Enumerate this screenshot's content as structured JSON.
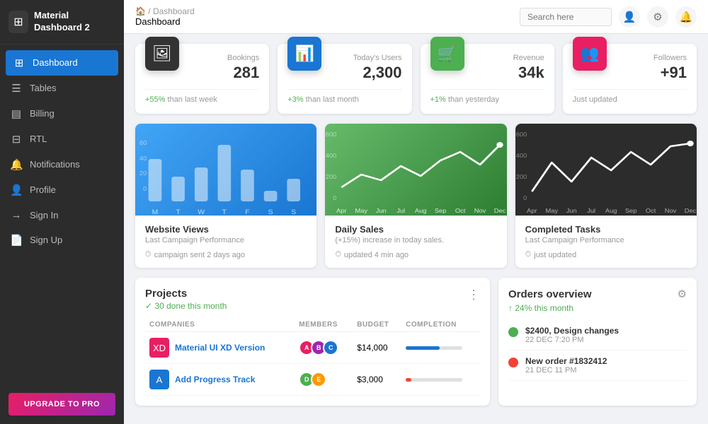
{
  "sidebar": {
    "logo": "Material Dashboard 2",
    "items": [
      {
        "label": "Dashboard",
        "icon": "⊞",
        "active": true
      },
      {
        "label": "Tables",
        "icon": "☰",
        "active": false
      },
      {
        "label": "Billing",
        "icon": "▤",
        "active": false
      },
      {
        "label": "RTL",
        "icon": "⊟",
        "active": false
      },
      {
        "label": "Notifications",
        "icon": "🔔",
        "active": false
      },
      {
        "label": "Profile",
        "icon": "👤",
        "active": false
      },
      {
        "label": "Sign In",
        "icon": "→",
        "active": false
      },
      {
        "label": "Sign Up",
        "icon": "📄",
        "active": false
      }
    ],
    "upgrade_label": "UPGRADE TO PRO"
  },
  "header": {
    "breadcrumb_home": "🏠",
    "breadcrumb_separator": "/",
    "breadcrumb_page": "Dashboard",
    "title": "Dashboard",
    "search_placeholder": "Search here",
    "icons": [
      "👤",
      "⚙",
      "🔔"
    ]
  },
  "stats": [
    {
      "label": "Bookings",
      "value": "281",
      "icon": "🖼",
      "icon_bg": "#333",
      "footer": "+55% than last week",
      "positive": true
    },
    {
      "label": "Today's Users",
      "value": "2,300",
      "icon": "📊",
      "icon_bg": "#1976d2",
      "footer": "+3% than last month",
      "positive": true
    },
    {
      "label": "Revenue",
      "value": "34k",
      "icon": "🛒",
      "icon_bg": "#4caf50",
      "footer": "+1% than yesterday",
      "positive": true
    },
    {
      "label": "Followers",
      "value": "+91",
      "icon": "👥",
      "icon_bg": "#e91e63",
      "footer": "Just updated",
      "positive": false
    }
  ],
  "charts": [
    {
      "title": "Website Views",
      "subtitle": "Last Campaign Performance",
      "footer": "campaign sent 2 days ago",
      "type": "bar",
      "theme": "blue",
      "labels": [
        "M",
        "T",
        "W",
        "T",
        "F",
        "S",
        "S"
      ],
      "values": [
        40,
        20,
        28,
        50,
        30,
        10,
        20
      ]
    },
    {
      "title": "Daily Sales",
      "subtitle": "(+15%) increase in today sales.",
      "footer": "updated 4 min ago",
      "type": "line",
      "theme": "green",
      "labels": [
        "Apr",
        "May",
        "Jun",
        "Jul",
        "Aug",
        "Sep",
        "Oct",
        "Nov",
        "Dec"
      ],
      "values": [
        200,
        300,
        250,
        350,
        280,
        380,
        420,
        300,
        450
      ]
    },
    {
      "title": "Completed Tasks",
      "subtitle": "Last Campaign Performance",
      "footer": "just updated",
      "type": "line",
      "theme": "dark",
      "labels": [
        "Apr",
        "May",
        "Jun",
        "Jul",
        "Aug",
        "Sep",
        "Oct",
        "Nov",
        "Dec"
      ],
      "values": [
        150,
        350,
        200,
        400,
        300,
        450,
        350,
        500,
        520
      ]
    }
  ],
  "projects": {
    "title": "Projects",
    "done_label": "✓ 30 done this month",
    "columns": [
      "COMPANIES",
      "MEMBERS",
      "BUDGET",
      "COMPLETION"
    ],
    "rows": [
      {
        "icon": "XD",
        "icon_bg": "#e91e63",
        "name": "Material UI XD Version",
        "budget": "$14,000",
        "completion": 60
      },
      {
        "icon": "A",
        "icon_bg": "#1976d2",
        "name": "Add Progress Track",
        "budget": "$3,000",
        "completion": 10
      }
    ]
  },
  "orders": {
    "title": "Orders overview",
    "growth": "↑ 24% this month",
    "items": [
      {
        "dot_color": "#4caf50",
        "name": "$2400, Design changes",
        "date": "22 DEC 7:20 PM"
      },
      {
        "dot_color": "#f44336",
        "name": "New order #1832412",
        "date": "21 DEC 11 PM"
      }
    ]
  }
}
